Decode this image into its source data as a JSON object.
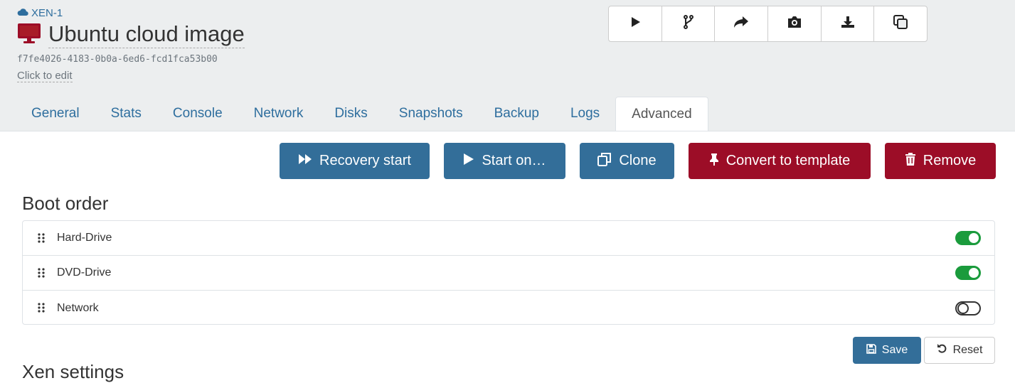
{
  "header": {
    "pool": "XEN-1",
    "vm_name": "Ubuntu cloud image",
    "uuid": "f7fe4026-4183-0b0a-6ed6-fcd1fca53b00",
    "edit_hint": "Click to edit"
  },
  "action_icons": [
    "play-icon",
    "branch-icon",
    "forward-icon",
    "camera-icon",
    "download-icon",
    "copy-icon"
  ],
  "tabs": [
    "General",
    "Stats",
    "Console",
    "Network",
    "Disks",
    "Snapshots",
    "Backup",
    "Logs",
    "Advanced"
  ],
  "active_tab": "Advanced",
  "buttons": {
    "recovery": "Recovery start",
    "start_on": "Start on…",
    "clone": "Clone",
    "convert": "Convert to template",
    "remove": "Remove"
  },
  "boot_order": {
    "title": "Boot order",
    "items": [
      {
        "label": "Hard-Drive",
        "enabled": true
      },
      {
        "label": "DVD-Drive",
        "enabled": true
      },
      {
        "label": "Network",
        "enabled": false
      }
    ]
  },
  "form": {
    "save": "Save",
    "reset": "Reset"
  },
  "next_section": "Xen settings",
  "colors": {
    "primary": "#336e99",
    "danger": "#9c0d27",
    "toggle_on": "#1a9b3c",
    "vm_icon": "#9c0d27"
  }
}
